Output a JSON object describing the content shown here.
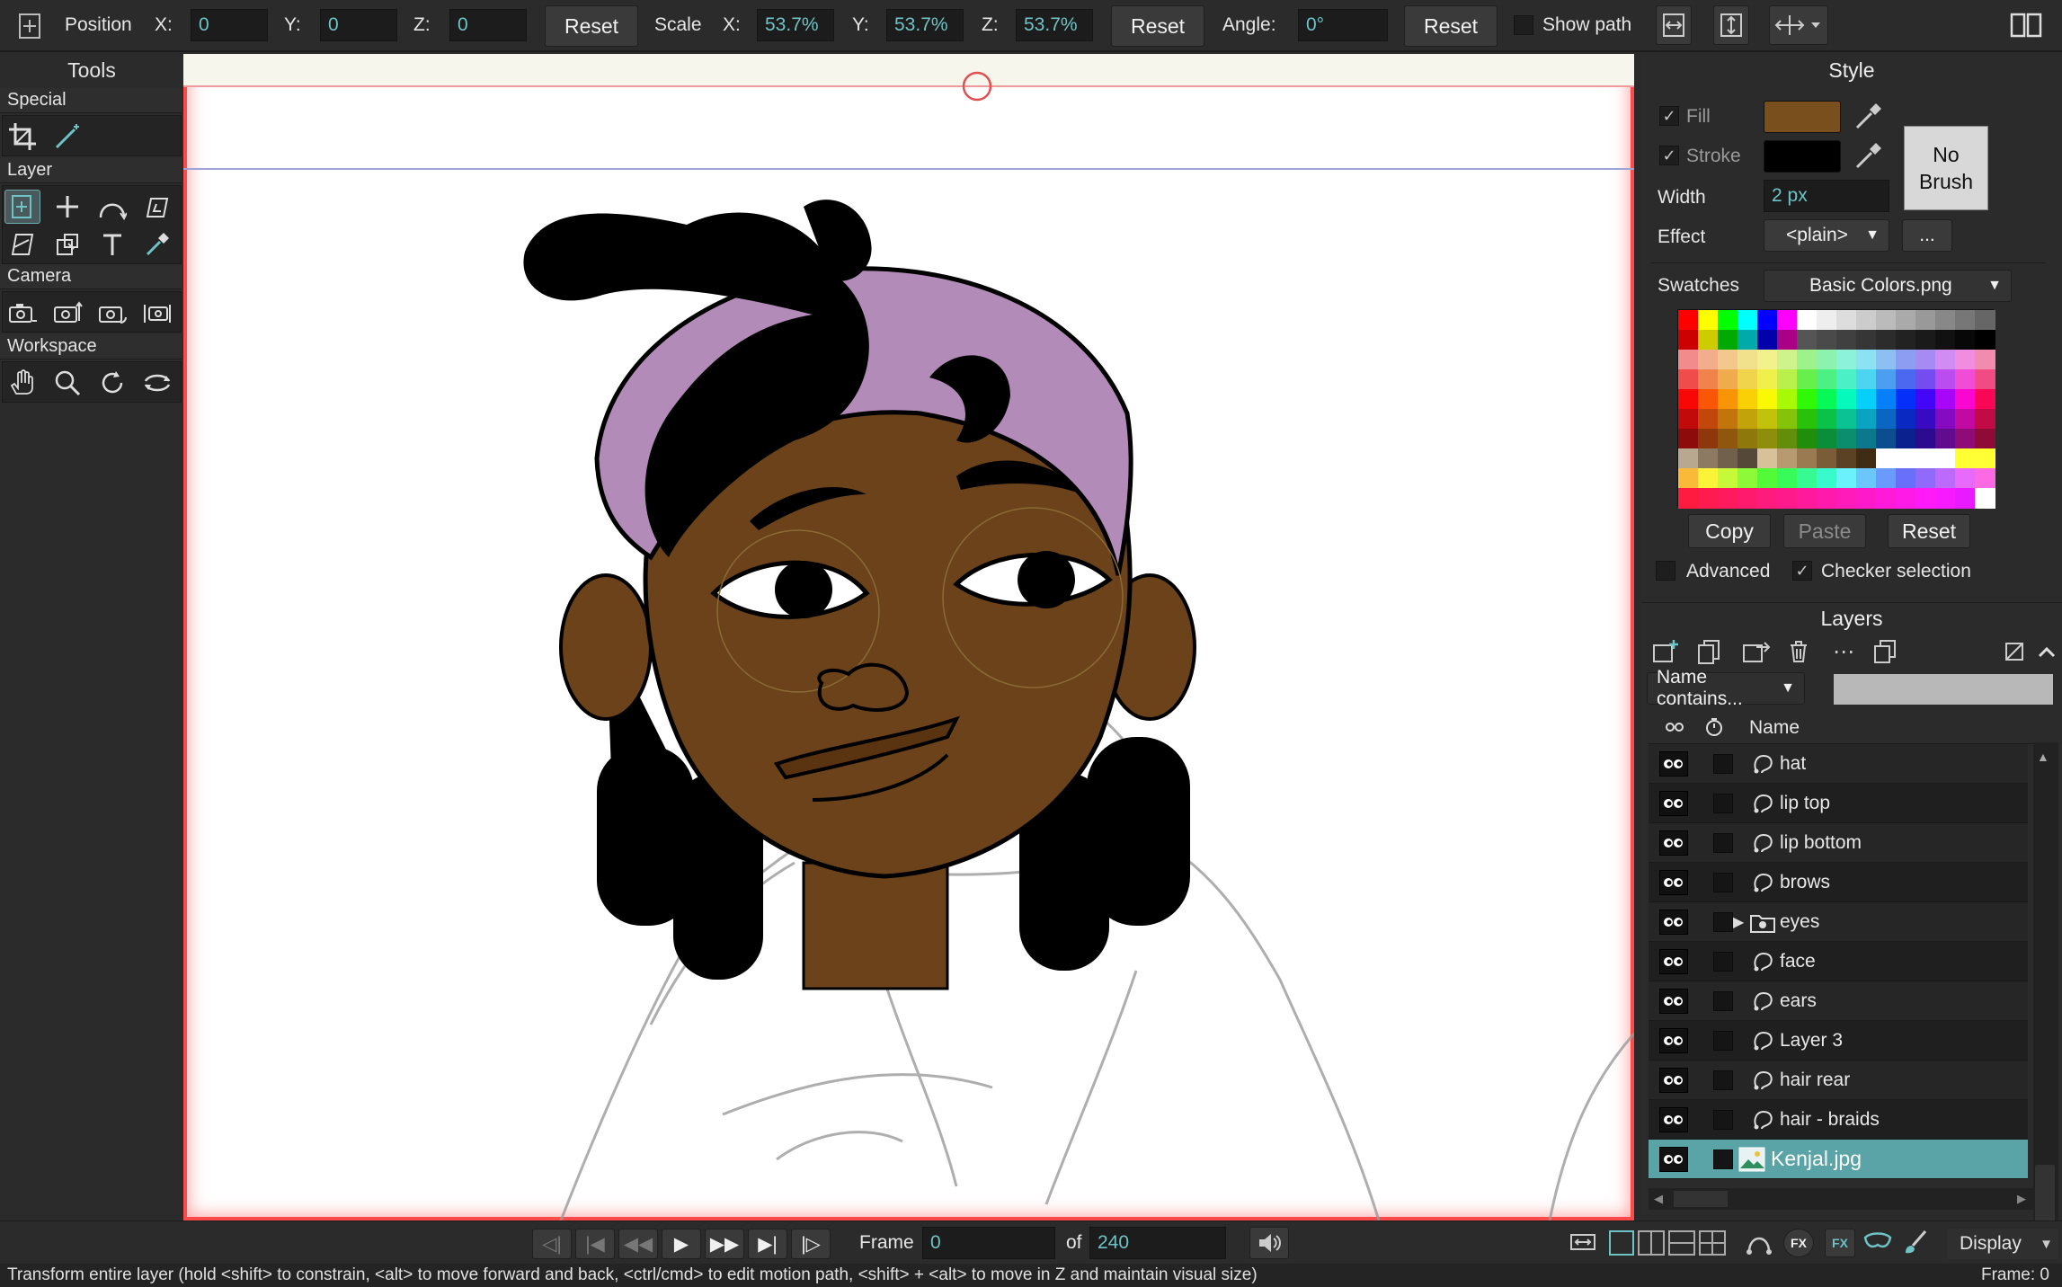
{
  "toolbar": {
    "position_label": "Position",
    "x_label": "X:",
    "x_value": "0",
    "y_label": "Y:",
    "y_value": "0",
    "z_label": "Z:",
    "z_value": "0",
    "reset_label": "Reset",
    "scale_label": "Scale",
    "sx_label": "X:",
    "sx_value": "53.7%",
    "sy_label": "Y:",
    "sy_value": "53.7%",
    "sz_label": "Z:",
    "sz_value": "53.7%",
    "angle_label": "Angle:",
    "angle_value": "0°",
    "show_path_label": "Show path"
  },
  "tools": {
    "title": "Tools",
    "sections": [
      "Special",
      "Layer",
      "Camera",
      "Workspace"
    ]
  },
  "style": {
    "title": "Style",
    "fill_label": "Fill",
    "fill_color": "#7a4f1e",
    "stroke_label": "Stroke",
    "stroke_color": "#000000",
    "width_label": "Width",
    "width_value": "2 px",
    "effect_label": "Effect",
    "effect_value": "<plain>",
    "effect_more": "...",
    "no_brush_line1": "No",
    "no_brush_line2": "Brush",
    "swatches_label": "Swatches",
    "swatches_value": "Basic Colors.png",
    "copy_label": "Copy",
    "paste_label": "Paste",
    "reset_label": "Reset",
    "advanced_label": "Advanced",
    "checker_label": "Checker selection"
  },
  "layers": {
    "title": "Layers",
    "filter_label": "Name contains...",
    "filter_value": "",
    "name_header": "Name",
    "items": [
      {
        "name": "hat",
        "kind": "vector"
      },
      {
        "name": "lip top",
        "kind": "vector"
      },
      {
        "name": "lip bottom",
        "kind": "vector"
      },
      {
        "name": "brows",
        "kind": "vector"
      },
      {
        "name": "eyes",
        "kind": "group"
      },
      {
        "name": "face",
        "kind": "vector"
      },
      {
        "name": "ears",
        "kind": "vector"
      },
      {
        "name": "Layer 3",
        "kind": "vector"
      },
      {
        "name": "hair rear",
        "kind": "vector"
      },
      {
        "name": "hair - braids",
        "kind": "vector"
      },
      {
        "name": "Kenjal.jpg",
        "kind": "image",
        "selected": true
      }
    ]
  },
  "timeline": {
    "frame_label": "Frame",
    "frame_value": "0",
    "of_label": "of",
    "total_frames": "240",
    "display_label": "Display"
  },
  "status": {
    "message": "Transform entire layer (hold <shift> to constrain, <alt> to move forward and back, <ctrl/cmd> to edit motion path, <shift> + <alt> to move in Z and maintain visual size)",
    "frame_readout": "Frame: 0"
  },
  "colors": {
    "accent": "#6fc3c6",
    "selection": "#5aa3a6",
    "canvas_border": "#ff4a4a"
  }
}
